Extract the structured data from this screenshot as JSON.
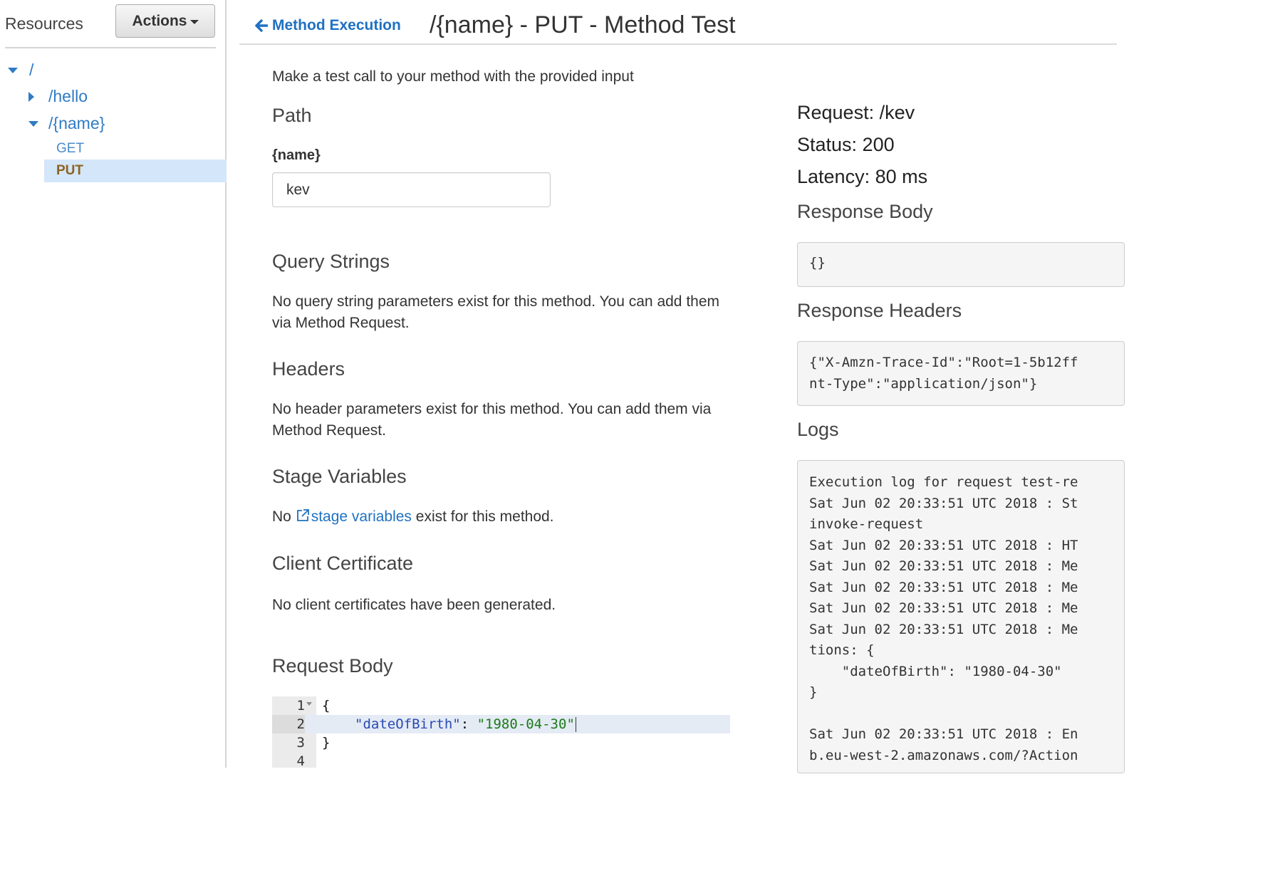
{
  "sidebar": {
    "title": "Resources",
    "actions_label": "Actions",
    "tree": {
      "root": "/",
      "hello": "/hello",
      "name": "/{name}",
      "methods": [
        "GET",
        "PUT"
      ]
    }
  },
  "header": {
    "back_label": "Method Execution",
    "title": "/{name} - PUT - Method Test"
  },
  "left": {
    "intro": "Make a test call to your method with the provided input",
    "path": {
      "heading": "Path",
      "param_label": "{name}",
      "param_value": "kev"
    },
    "query": {
      "heading": "Query Strings",
      "text": "No query string parameters exist for this method. You can add them via Method Request."
    },
    "headers": {
      "heading": "Headers",
      "text": "No header parameters exist for this method. You can add them via Method Request."
    },
    "stage": {
      "heading": "Stage Variables",
      "text_before": "No ",
      "link": "stage variables",
      "text_after": " exist for this method."
    },
    "cert": {
      "heading": "Client Certificate",
      "text": "No client certificates have been generated."
    },
    "body": {
      "heading": "Request Body",
      "line_numbers": [
        "1",
        "2",
        "3",
        "4"
      ],
      "line1": "{",
      "line2_key": "\"dateOfBirth\"",
      "line2_colon": ": ",
      "line2_value": "\"1980-04-30\"",
      "line3": "}"
    }
  },
  "right": {
    "request": "Request: /kev",
    "status": "Status: 200",
    "latency": "Latency: 80 ms",
    "response_body_heading": "Response Body",
    "response_body": "{}",
    "response_headers_heading": "Response Headers",
    "response_headers_lines": [
      "{\"X-Amzn-Trace-Id\":\"Root=1-5b12ff",
      "nt-Type\":\"application/json\"}"
    ],
    "logs_heading": "Logs",
    "log_lines": [
      "Execution log for request test-re",
      "Sat Jun 02 20:33:51 UTC 2018 : St",
      "invoke-request",
      "Sat Jun 02 20:33:51 UTC 2018 : HT",
      "Sat Jun 02 20:33:51 UTC 2018 : Me",
      "Sat Jun 02 20:33:51 UTC 2018 : Me",
      "Sat Jun 02 20:33:51 UTC 2018 : Me",
      "Sat Jun 02 20:33:51 UTC 2018 : Me",
      "tions: {",
      "    \"dateOfBirth\": \"1980-04-30\"",
      "}",
      "",
      "Sat Jun 02 20:33:51 UTC 2018 : En",
      "b.eu-west-2.amazonaws.com/?Action"
    ]
  },
  "colors": {
    "link_blue": "#1f71c1",
    "tree_blue": "#2f7bc4",
    "selected_bg": "#d4e6f9",
    "put_brown": "#8b6420",
    "json_key": "#2a4ab4",
    "json_string": "#1d7a18"
  },
  "icons": {
    "back": "arrow-left-icon",
    "external": "external-link-icon",
    "expanded": "caret-down-icon",
    "collapsed": "caret-right-icon"
  }
}
